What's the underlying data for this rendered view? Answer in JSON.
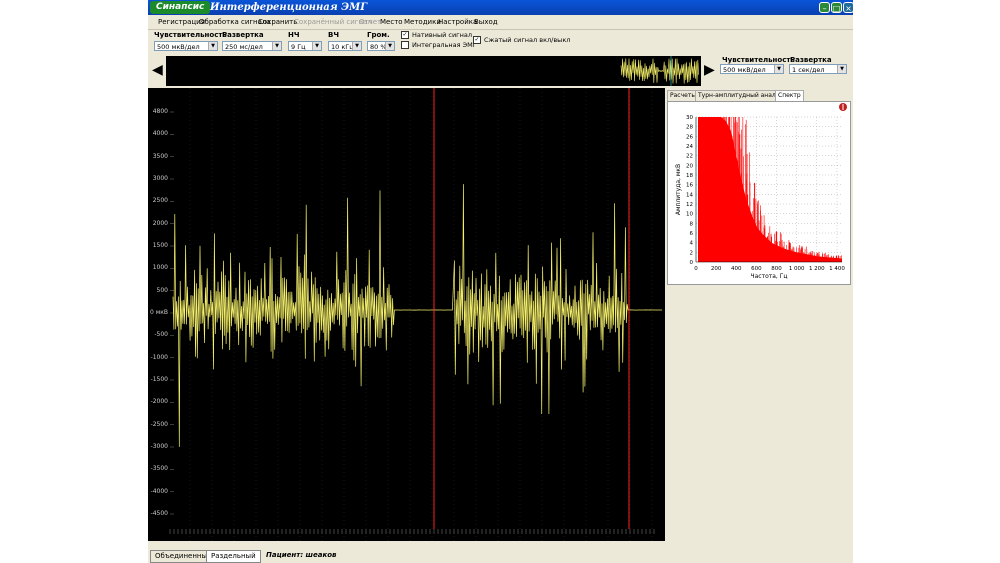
{
  "window": {
    "logo": "Синапсис",
    "title": "Интерференционная ЭМГ"
  },
  "menu": [
    {
      "label": "Регистрация",
      "enabled": true
    },
    {
      "label": "Обработка сигнала",
      "enabled": true
    },
    {
      "label": "Сохранить",
      "enabled": true
    },
    {
      "label": "Сохранённый сигнал",
      "enabled": false
    },
    {
      "label": "Отчет",
      "enabled": false
    },
    {
      "label": "Место",
      "enabled": true
    },
    {
      "label": "Методики",
      "enabled": true
    },
    {
      "label": "Настройка",
      "enabled": true
    },
    {
      "label": "Выход",
      "enabled": true
    }
  ],
  "toolbar": {
    "sensitivity": {
      "label": "Чувствительность",
      "value": "500 мкВ/дел"
    },
    "sweep": {
      "label": "Развертка",
      "value": "250 мс/дел"
    },
    "lowfreq": {
      "label": "НЧ",
      "value": "9 Гц"
    },
    "highfreq": {
      "label": "ВЧ",
      "value": "10 кГц"
    },
    "volume": {
      "label": "Гром.",
      "value": "80 %"
    },
    "native_signal": {
      "label": "Нативный сигнал",
      "checked": true
    },
    "integral_emg": {
      "label": "Интегральная ЭМГ",
      "checked": false
    },
    "compressed": {
      "label": "Сжатый сигнал вкл/выкл",
      "checked": true
    }
  },
  "overview_settings": {
    "sensitivity": {
      "label": "Чувствительность",
      "value": "500 мкВ/дел"
    },
    "sweep": {
      "label": "Развертка",
      "value": "1 сек/дел"
    }
  },
  "main_plot": {
    "y_labels": [
      "4800",
      "4000",
      "3500",
      "3000",
      "2500",
      "2000",
      "1500",
      "1000",
      "500",
      "0 мкВ",
      "-500",
      "-1000",
      "-1500",
      "-2000",
      "-2500",
      "-3000",
      "-3500",
      "-4000",
      "-4500"
    ]
  },
  "right_panel": {
    "tabs": [
      {
        "label": "Расчеты",
        "active": false
      },
      {
        "label": "Турн-амплитудный анализ",
        "active": false
      },
      {
        "label": "Спектр",
        "active": true
      }
    ]
  },
  "chart_data": {
    "type": "area",
    "title": "",
    "xlabel": "Частота, Гц",
    "ylabel": "Амплитуда, мкВ",
    "xlim": [
      0,
      1450
    ],
    "ylim": [
      0,
      30
    ],
    "x_ticks": [
      "0",
      "200",
      "400",
      "600",
      "800",
      "1 000",
      "1 200",
      "1 400"
    ],
    "y_ticks": [
      "0",
      "2",
      "4",
      "6",
      "8",
      "10",
      "12",
      "14",
      "16",
      "18",
      "20",
      "22",
      "24",
      "26",
      "28",
      "30"
    ],
    "x": [
      20,
      50,
      100,
      150,
      200,
      250,
      300,
      350,
      400,
      450,
      500,
      550,
      600,
      650,
      700,
      750,
      800,
      850,
      900,
      950,
      1000,
      1050,
      1100,
      1150,
      1200,
      1250,
      1300,
      1350,
      1400,
      1450
    ],
    "values": [
      30,
      30,
      30,
      30,
      30,
      30,
      29,
      27,
      22,
      17,
      13,
      10,
      7.5,
      6,
      5,
      4,
      3.5,
      3,
      2.6,
      2.3,
      2,
      1.8,
      1.6,
      1.4,
      1.2,
      1.1,
      1,
      0.9,
      0.8,
      0.7
    ],
    "grid": true,
    "color": "#ff0000"
  },
  "statusbar": {
    "tabs": [
      {
        "label": "Объединенный",
        "active": false
      },
      {
        "label": "Раздельный",
        "active": true
      }
    ],
    "patient": "Пациент: шеаков"
  },
  "colors": {
    "signal": "#f5f06a",
    "marker": "#ff2020",
    "titlebar": "#0a4fd0"
  }
}
